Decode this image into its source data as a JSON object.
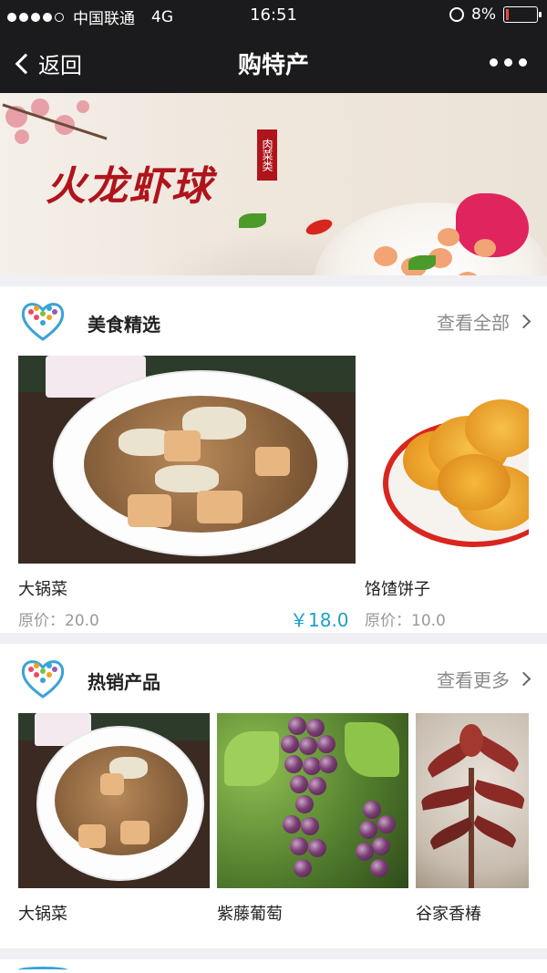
{
  "status_bar": {
    "carrier": "中国联通",
    "network": "4G",
    "time": "16:51",
    "battery": "8%"
  },
  "nav": {
    "back_label": "返回",
    "title": "购特产"
  },
  "banner": {
    "headline": "火龙虾球",
    "seal": "肉菜类",
    "slides": 2,
    "active_slide": 2
  },
  "featured": {
    "title": "美食精选",
    "more_label": "查看全部",
    "items": [
      {
        "name": "大锅菜",
        "orig_label": "原价：20.0",
        "price": "￥18.0"
      },
      {
        "name": "饹馇饼子",
        "orig_label": "原价：10.0"
      }
    ]
  },
  "hot": {
    "title": "热销产品",
    "more_label": "查看更多",
    "items": [
      {
        "name": "大锅菜"
      },
      {
        "name": "紫藤葡萄"
      },
      {
        "name": "谷家香椿"
      }
    ]
  },
  "colors": {
    "navbar": "#1b1b1d",
    "accent_price": "#1aa0c7",
    "pager_active": "#2196d3",
    "banner_text": "#b0141b"
  }
}
